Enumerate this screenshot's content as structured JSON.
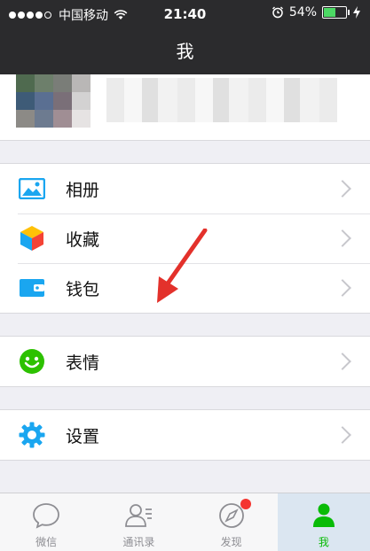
{
  "status_bar": {
    "carrier": "中国移动",
    "time": "21:40",
    "battery_percent": "54%",
    "battery_level": 0.54,
    "signal_bars": 4
  },
  "nav": {
    "title": "我"
  },
  "menu": {
    "group1": [
      {
        "label": "相册",
        "icon": "photo-album-icon"
      },
      {
        "label": "收藏",
        "icon": "favorites-cube-icon"
      },
      {
        "label": "钱包",
        "icon": "wallet-icon"
      }
    ],
    "group2": [
      {
        "label": "表情",
        "icon": "smiley-icon"
      }
    ],
    "group3": [
      {
        "label": "设置",
        "icon": "gear-icon"
      }
    ]
  },
  "tabs": [
    {
      "label": "微信",
      "icon": "chat-bubble-icon",
      "active": false
    },
    {
      "label": "通讯录",
      "icon": "contacts-icon",
      "active": false
    },
    {
      "label": "发现",
      "icon": "compass-icon",
      "active": false,
      "badge": true
    },
    {
      "label": "我",
      "icon": "person-icon",
      "active": true
    }
  ],
  "colors": {
    "accent_green": "#09bb07",
    "header_bg": "#2b2b2d",
    "icon_blue": "#1aa6f0",
    "badge_red": "#f43530"
  }
}
